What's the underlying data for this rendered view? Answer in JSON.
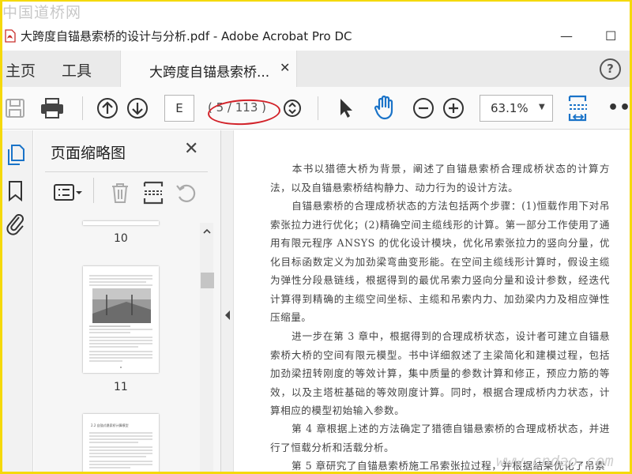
{
  "watermark": {
    "top": "中国道桥网",
    "bottom": "www.cndao.com"
  },
  "window": {
    "title": "大跨度自锚悬索桥的设计与分析.pdf - Adobe Acrobat Pro DC",
    "minimize": "—",
    "maximize": "☐"
  },
  "tabs": {
    "home": "主页",
    "tools": "工具",
    "document": "大跨度自锚悬索桥...",
    "close": "✕",
    "help": "?"
  },
  "toolbar": {
    "page_field": "E",
    "page_count": "( 5 / 113 )",
    "zoom": "63.1%",
    "zoom_caret": "▼",
    "more": "•••"
  },
  "panel": {
    "title": "页面缩略图",
    "close": "✕",
    "thumbnails": [
      {
        "label": "10"
      },
      {
        "label": "11"
      }
    ],
    "thumb_heading": "2.2  自锚式悬索桥计算模型"
  },
  "document": {
    "paragraphs": [
      "本书以猎德大桥为背景，阐述了自锚悬索桥合理成桥状态的计算方法，以及自锚悬索桥结构静力、动力行为的设计方法。",
      "自锚悬索桥的合理成桥状态的方法包括两个步骤：(1)恒载作用下对吊索张拉力进行优化；(2)精确空间主缆线形的计算。第一部分工作使用了通用有限元程序 ANSYS 的优化设计模块，优化吊索张拉力的竖向分量，优化目标函数定义为加劲梁弯曲变形能。在空间主缆线形计算时，假设主缆为弹性分段悬链线，根据得到的最优吊索力竖向分量和设计参数，经迭代计算得到精确的主缆空间坐标、主缆和吊索内力、加劲梁内力及相应弹性压缩量。",
      "进一步在第 3 章中，根据得到的合理成桥状态，设计者可建立自锚悬索桥大桥的空间有限元模型。书中详细叙述了主梁简化和建模过程，包括加劲梁扭转刚度的等效计算，集中质量的参数计算和修正，预应力筋的等效，以及主塔桩基础的等效刚度计算。同时，根据合理成桥内力状态，计算相应的模型初始输入参数。",
      "第 4 章根据上述的方法确定了猎德自锚悬索桥的合理成桥状态，并进行了恒载分析和活载分析。",
      "第 5 章研究了自锚悬索桥施工吊索张拉过程，并根据结果优化了吊索"
    ]
  },
  "colors": {
    "frame": "#f5d90a",
    "accent_blue": "#1a73c8",
    "annotation_red": "#d2232a"
  }
}
